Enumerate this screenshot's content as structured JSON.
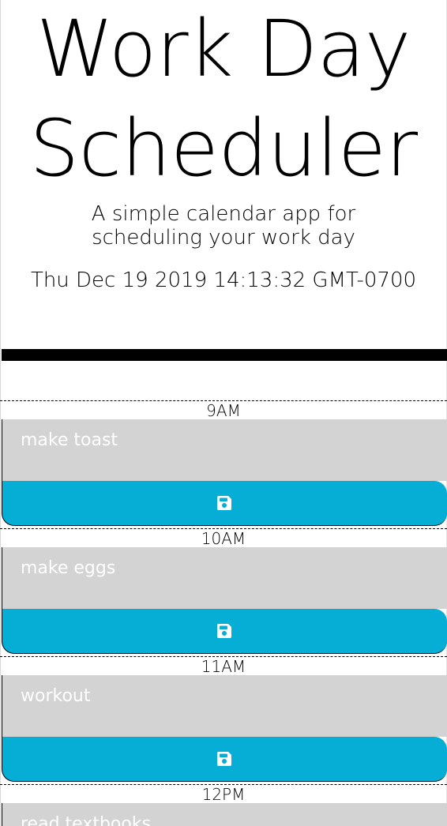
{
  "header": {
    "title_line1": "Work Day",
    "title_line2": "Scheduler",
    "lead_line1": "A simple calendar app for",
    "lead_line2": "scheduling your work day",
    "current_day": "Thu Dec 19 2019 14:13:32 GMT-0700"
  },
  "colors": {
    "save_button": "#06aed5",
    "past_block": "#d3d3d3",
    "description_text": "#ffffff"
  },
  "icons": {
    "save": "floppy-disk-icon"
  },
  "blocks": [
    {
      "hour": "9AM",
      "description": "make toast"
    },
    {
      "hour": "10AM",
      "description": "make eggs"
    },
    {
      "hour": "11AM",
      "description": "workout"
    },
    {
      "hour": "12PM",
      "description": "read textbooks"
    }
  ]
}
